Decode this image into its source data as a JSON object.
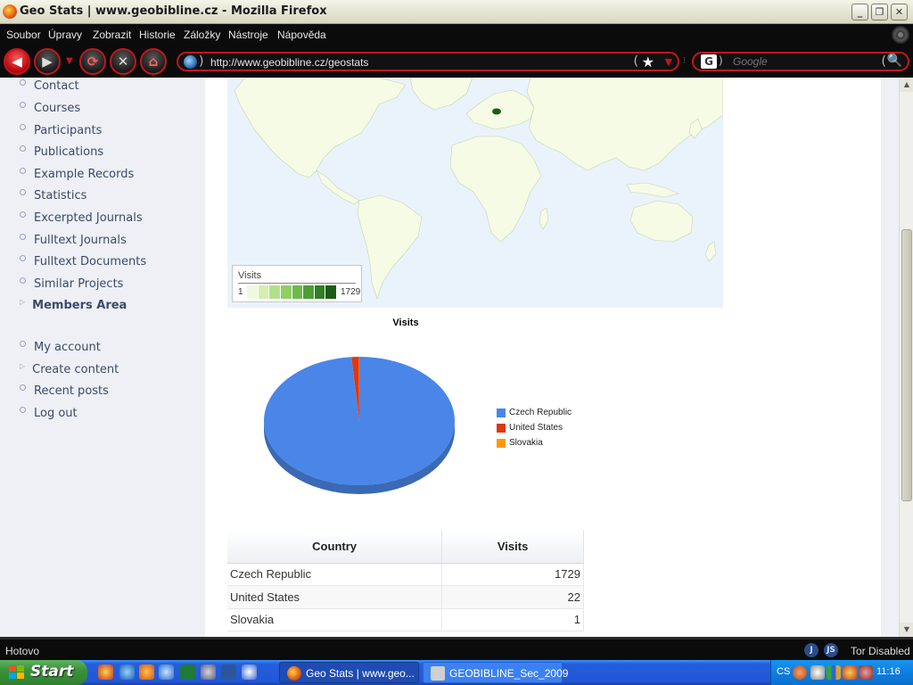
{
  "window": {
    "title": "Geo Stats | www.geobibline.cz - Mozilla Firefox",
    "minimize_label": "_",
    "maximize_label": "❐",
    "close_label": "✕"
  },
  "menu": {
    "items": [
      "Soubor",
      "Úpravy",
      "Zobrazit",
      "Historie",
      "Záložky",
      "Nástroje",
      "Nápověda"
    ]
  },
  "navbar": {
    "url": "http://www.geobibline.cz/geostats",
    "search_placeholder": "Google",
    "search_engine_letter": "G"
  },
  "sidebar": {
    "primary_items": [
      {
        "label": "Contact"
      },
      {
        "label": "Courses"
      },
      {
        "label": "Participants"
      },
      {
        "label": "Publications"
      },
      {
        "label": "Example Records"
      },
      {
        "label": "Statistics"
      },
      {
        "label": "Excerpted Journals"
      },
      {
        "label": "Fulltext Journals"
      },
      {
        "label": "Fulltext Documents"
      },
      {
        "label": "Similar Projects"
      },
      {
        "label": "Members Area"
      }
    ],
    "user_items": [
      {
        "label": "My account"
      },
      {
        "label": "Create content"
      },
      {
        "label": "Recent posts"
      },
      {
        "label": "Log out"
      }
    ]
  },
  "map": {
    "legend_title": "Visits",
    "legend_min": "1",
    "legend_max": "1729",
    "legend_colors": [
      "#f0f9e0",
      "#d4efb0",
      "#b2e08a",
      "#8fcf66",
      "#6db94a",
      "#4c9e35",
      "#2f7f24",
      "#1b5c16"
    ],
    "land_color": "#f6fbe6",
    "ocean_color": "#eaf3fb",
    "highlight_color": "#1b5c16"
  },
  "chart_data": {
    "type": "pie",
    "title": "Visits",
    "categories": [
      "Czech Republic",
      "United States",
      "Slovakia"
    ],
    "values": [
      1729,
      22,
      1
    ],
    "colors": [
      "#4a86e8",
      "#dc3912",
      "#ff9900"
    ],
    "legend_position": "right"
  },
  "table": {
    "headers": [
      "Country",
      "Visits"
    ],
    "rows": [
      [
        "Czech Republic",
        "1729"
      ],
      [
        "United States",
        "22"
      ],
      [
        "Slovakia",
        "1"
      ]
    ]
  },
  "statusbar": {
    "status": "Hotovo",
    "tor_status": "Tor Disabled",
    "icon_j": "J",
    "icon_js": "JS"
  },
  "taskbar": {
    "start_label": "Start",
    "tasks": [
      {
        "label": "Geo Stats | www.geo...",
        "active": true
      },
      {
        "label": "GEOBIBLINE_Sec_2009",
        "active": false
      }
    ],
    "lang": "CS",
    "clock": "11:16"
  }
}
